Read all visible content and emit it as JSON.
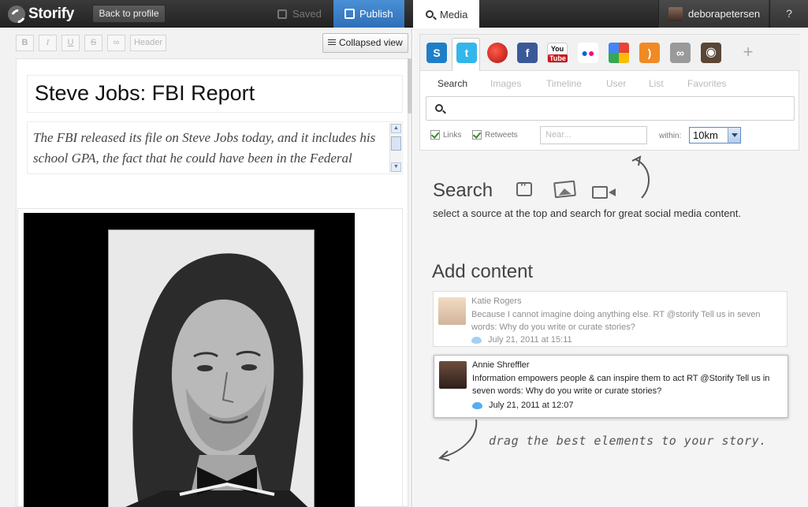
{
  "topbar": {
    "logo_text": "Storify",
    "back_label": "Back to profile",
    "saved_label": "Saved",
    "publish_label": "Publish",
    "media_label": "Media",
    "username": "deborapetersen",
    "help_label": "?"
  },
  "toolbar": {
    "bold": "B",
    "italic": "I",
    "underline": "U",
    "strike": "S",
    "header": "Header",
    "collapsed_label": "Collapsed view"
  },
  "story": {
    "title": "Steve Jobs: FBI Report",
    "description": "The FBI released its file on Steve Jobs today, and it includes his school GPA, the fact that he could have been in the Federal administration and..."
  },
  "media": {
    "sources": [
      {
        "name": "storify-icon",
        "color": "#1e7fc8",
        "glyph": "S"
      },
      {
        "name": "twitter-icon",
        "color": "#33b6ea",
        "glyph": "t"
      },
      {
        "name": "web-icon",
        "color": "#d8241f",
        "glyph": "●"
      },
      {
        "name": "facebook-icon",
        "color": "#3b5998",
        "glyph": "f"
      },
      {
        "name": "youtube-icon",
        "color": "#cc181e",
        "glyph": "You"
      },
      {
        "name": "flickr-icon",
        "color": "#ffffff",
        "glyph": "••"
      },
      {
        "name": "google-icon",
        "color": "#4caf50",
        "glyph": "g"
      },
      {
        "name": "rss-icon",
        "color": "#f08a24",
        "glyph": ")"
      },
      {
        "name": "link-icon",
        "color": "#9a9a9a",
        "glyph": "∞"
      },
      {
        "name": "instagram-icon",
        "color": "#5a4636",
        "glyph": "◉"
      }
    ],
    "add_source": "+",
    "subtabs": [
      "Search",
      "Images",
      "Timeline",
      "User",
      "List",
      "Favorites"
    ],
    "search_placeholder": "",
    "links_label": "Links",
    "retweets_label": "Retweets",
    "near_placeholder": "Near...",
    "within_label": "within:",
    "within_value": "10km"
  },
  "panel": {
    "search_heading": "Search",
    "search_help": "select a source at the top and search for great social media content.",
    "add_heading": "Add content",
    "drag_note": "drag the best elements to your story."
  },
  "tweets": [
    {
      "author": "Katie Rogers",
      "text": "Because I cannot imagine doing anything else. RT @storify Tell us in seven words: Why do you write or curate stories?",
      "time": "July 21, 2011 at 15:11"
    },
    {
      "author": "Annie Shreffler",
      "text": "Information empowers people & can inspire them to act RT @Storify Tell us in seven words: Why do you write or curate stories?",
      "time": "July 21, 2011 at 12:07"
    }
  ]
}
